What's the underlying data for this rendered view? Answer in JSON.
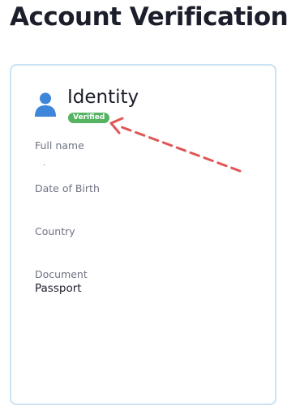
{
  "page": {
    "title": "Account Verification"
  },
  "identity": {
    "title": "Identity",
    "status_badge": "Verified",
    "fields": [
      {
        "label": "Full name",
        "value": ""
      },
      {
        "label": "Date of Birth",
        "value": ""
      },
      {
        "label": "Country",
        "value": ""
      },
      {
        "label": "Document",
        "value": "Passport"
      }
    ]
  },
  "colors": {
    "badge": "#55b362",
    "card_border": "#c9e3f4",
    "avatar": "#3d86d9",
    "annotation_arrow": "#e05555"
  },
  "icons": {
    "avatar": "user-icon"
  }
}
